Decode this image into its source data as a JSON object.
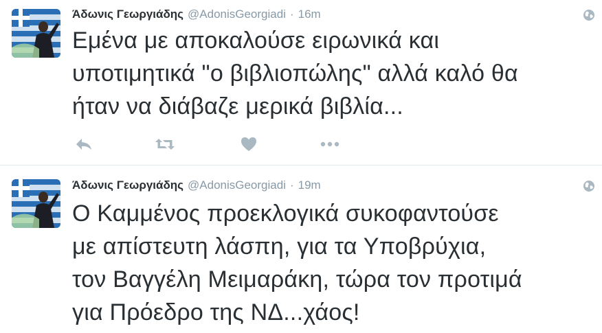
{
  "tweets": [
    {
      "fullname": "Άδωνις Γεωργιάδης",
      "handle": "@AdonisGeorgiadi",
      "separator": "·",
      "time": "16m",
      "text_lines": [
        "Εμένα με αποκαλούσε ειρωνικά και",
        "υποτιμητικά \"ο βιβλιοπώλης\" αλλά καλό θα",
        "ήταν να διάβαζε μερικά βιβλία..."
      ],
      "actions": [
        "reply-icon",
        "retweet-icon",
        "like-icon",
        "more-icon"
      ]
    },
    {
      "fullname": "Άδωνις Γεωργιάδης",
      "handle": "@AdonisGeorgiadi",
      "separator": "·",
      "time": "19m",
      "text_lines": [
        "Ο Καμμένος προεκλογικά συκοφαντούσε",
        "με απίστευτη λάσπη, για τα Υποβρύχια,",
        "τον Βαγγέλη Μειμαράκη, τώρα τον προτιμά",
        "για Πρόεδρο της ΝΔ...χάος!"
      ]
    }
  ],
  "colors": {
    "text": "#292f33",
    "muted": "#8899a6",
    "icon": "#aab8c2",
    "divider": "#e1e8ed"
  }
}
